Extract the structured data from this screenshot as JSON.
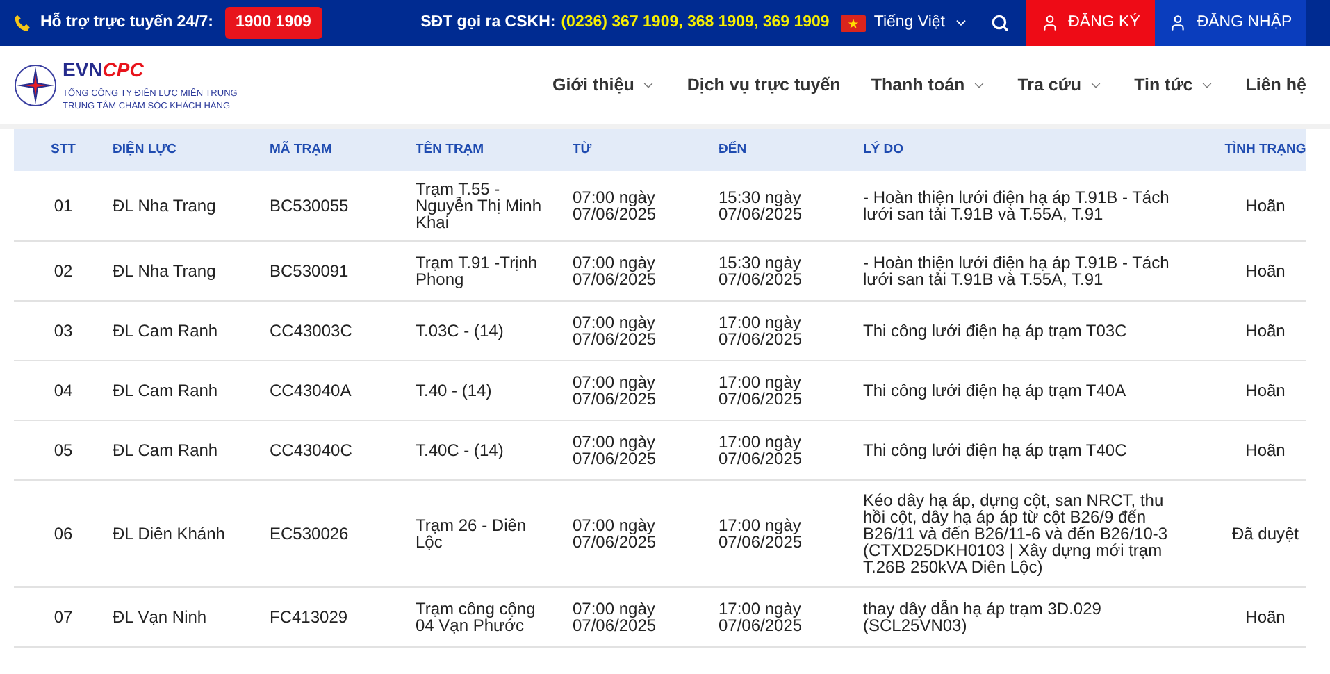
{
  "topbar": {
    "support_label": "Hỗ trợ trực tuyến 24/7:",
    "hotline": "1900 1909",
    "cskh_label": "SĐT gọi ra CSKH:",
    "cskh_numbers": "(0236) 367 1909, 368 1909, 369 1909",
    "language": "Tiếng Việt",
    "register": "ĐĂNG KÝ",
    "login": "ĐĂNG NHẬP"
  },
  "logo": {
    "brand": "EVN",
    "brand_accent": "CPC",
    "line_1": "TỔNG CÔNG TY ĐIỆN LỰC MIỀN TRUNG",
    "line_2": "TRUNG TÂM CHĂM SÓC KHÁCH HÀNG"
  },
  "nav": [
    {
      "label": "Giới thiệu",
      "has_menu": true
    },
    {
      "label": "Dịch vụ trực tuyến",
      "has_menu": false
    },
    {
      "label": "Thanh toán",
      "has_menu": true
    },
    {
      "label": "Tra cứu",
      "has_menu": true
    },
    {
      "label": "Tin tức",
      "has_menu": true
    },
    {
      "label": "Liên hệ",
      "has_menu": false
    }
  ],
  "table": {
    "columns": [
      "STT",
      "ĐIỆN LỰC",
      "MÃ TRẠM",
      "TÊN TRẠM",
      "TỪ",
      "ĐẾN",
      "LÝ DO",
      "TÌNH TRẠNG"
    ],
    "rows": [
      {
        "stt": "01",
        "dien_luc": "ĐL Nha Trang",
        "ma_tram": "BC530055",
        "ten_tram": [
          "Trạm T.55 -",
          "Nguyễn Thị Minh",
          "Khai"
        ],
        "tu": [
          "07:00 ngày",
          "07/06/2025"
        ],
        "den": [
          "15:30 ngày",
          "07/06/2025"
        ],
        "ly_do": [
          "- Hoàn thiện lưới điện hạ áp T.91B - Tách",
          "lưới san tải T.91B và T.55A, T.91"
        ],
        "tinh_trang": "Hoãn"
      },
      {
        "stt": "02",
        "dien_luc": "ĐL Nha Trang",
        "ma_tram": "BC530091",
        "ten_tram": [
          "Trạm T.91 -Trịnh",
          "Phong"
        ],
        "tu": [
          "07:00 ngày",
          "07/06/2025"
        ],
        "den": [
          "15:30 ngày",
          "07/06/2025"
        ],
        "ly_do": [
          "- Hoàn thiện lưới điện hạ áp T.91B - Tách",
          "lưới san tải T.91B và T.55A, T.91"
        ],
        "tinh_trang": "Hoãn"
      },
      {
        "stt": "03",
        "dien_luc": "ĐL Cam Ranh",
        "ma_tram": "CC43003C",
        "ten_tram": [
          "T.03C - (14)"
        ],
        "tu": [
          "07:00 ngày",
          "07/06/2025"
        ],
        "den": [
          "17:00 ngày",
          "07/06/2025"
        ],
        "ly_do": [
          "Thi công lưới điện hạ áp trạm T03C"
        ],
        "tinh_trang": "Hoãn"
      },
      {
        "stt": "04",
        "dien_luc": "ĐL Cam Ranh",
        "ma_tram": "CC43040A",
        "ten_tram": [
          "T.40 - (14)"
        ],
        "tu": [
          "07:00 ngày",
          "07/06/2025"
        ],
        "den": [
          "17:00 ngày",
          "07/06/2025"
        ],
        "ly_do": [
          "Thi công lưới điện hạ áp trạm T40A"
        ],
        "tinh_trang": "Hoãn"
      },
      {
        "stt": "05",
        "dien_luc": "ĐL Cam Ranh",
        "ma_tram": "CC43040C",
        "ten_tram": [
          "T.40C - (14)"
        ],
        "tu": [
          "07:00 ngày",
          "07/06/2025"
        ],
        "den": [
          "17:00 ngày",
          "07/06/2025"
        ],
        "ly_do": [
          "Thi công lưới điện hạ áp trạm T40C"
        ],
        "tinh_trang": "Hoãn"
      },
      {
        "stt": "06",
        "dien_luc": "ĐL Diên Khánh",
        "ma_tram": "EC530026",
        "ten_tram": [
          "Trạm 26 - Diên",
          "Lộc"
        ],
        "tu": [
          "07:00 ngày",
          "07/06/2025"
        ],
        "den": [
          "17:00 ngày",
          "07/06/2025"
        ],
        "ly_do": [
          "Kéo dây hạ áp, dựng cột, san NRCT, thu",
          "hồi cột, dây hạ áp áp từ cột B26/9 đến",
          "B26/11 và đến B26/11-6 và đến B26/10-3",
          "(CTXD25DKH0103 | Xây dựng mới trạm",
          "T.26B 250kVA Diên Lộc)"
        ],
        "tinh_trang": "Đã duyệt"
      },
      {
        "stt": "07",
        "dien_luc": "ĐL Vạn Ninh",
        "ma_tram": "FC413029",
        "ten_tram": [
          "Trạm công cộng",
          "04 Vạn Phước"
        ],
        "tu": [
          "07:00 ngày",
          "07/06/2025"
        ],
        "den": [
          "17:00 ngày",
          "07/06/2025"
        ],
        "ly_do": [
          "thay dây dẫn hạ áp trạm 3D.029",
          "(SCL25VN03)"
        ],
        "tinh_trang": "Hoãn"
      }
    ]
  }
}
